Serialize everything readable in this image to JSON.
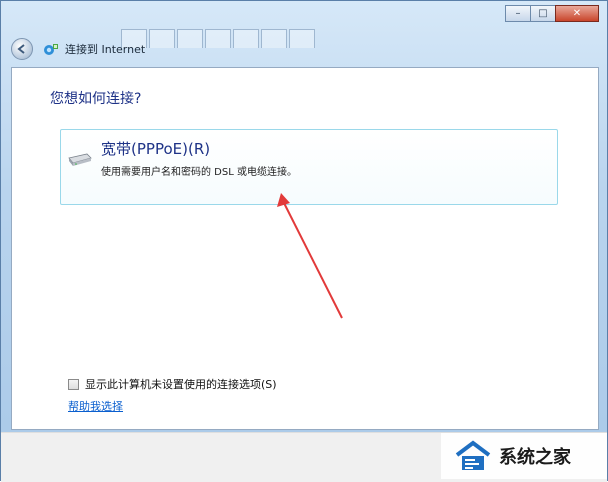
{
  "window": {
    "title": "连接到 Internet",
    "background_tabs": [
      "",
      "",
      "",
      "",
      "",
      "",
      ""
    ],
    "caption": {
      "minimize_glyph": "–",
      "maximize_glyph": "□",
      "close_glyph": "✕"
    }
  },
  "main": {
    "heading": "您想如何连接?",
    "option": {
      "title": "宽带(PPPoE)(R)",
      "description": "使用需要用户名和密码的 DSL 或电缆连接。",
      "icon": "modem-icon"
    },
    "show_options_checkbox": {
      "label": "显示此计算机未设置使用的连接选项(S)",
      "checked": false
    },
    "help_link": "帮助我选择"
  },
  "watermark": {
    "text": "系统之家"
  },
  "colors": {
    "heading": "#1e3287",
    "link": "#0a5fcf",
    "annotation_arrow": "#e23a3a",
    "option_border": "#9ad8ea"
  }
}
